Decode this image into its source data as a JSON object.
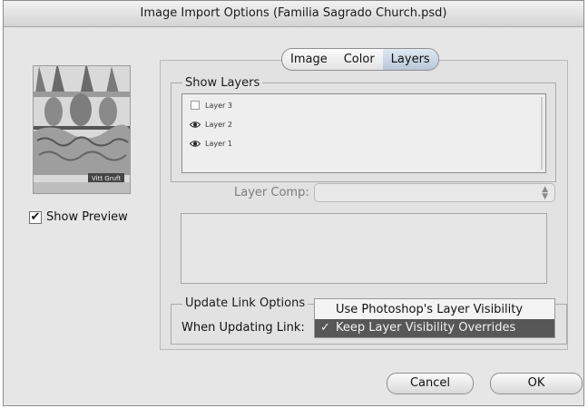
{
  "dialog": {
    "title": "Image Import Options (Familia Sagrado Church.psd)"
  },
  "preview": {
    "show_preview_label": "Show Preview",
    "show_preview_checked": true,
    "thumbnail_caption": "Vitt Gruft"
  },
  "tabs": [
    {
      "label": "Image",
      "active": false
    },
    {
      "label": "Color",
      "active": false
    },
    {
      "label": "Layers",
      "active": true
    }
  ],
  "show_layers": {
    "label": "Show Layers",
    "layers": [
      {
        "name": "Layer 3",
        "visible": false,
        "icon": "empty-checkbox"
      },
      {
        "name": "Layer 2",
        "visible": true,
        "icon": "eye-icon"
      },
      {
        "name": "Layer 1",
        "visible": true,
        "icon": "eye-icon"
      }
    ]
  },
  "layer_comp": {
    "label": "Layer Comp:",
    "value": ""
  },
  "update_link_options": {
    "group_label": "Update Link Options",
    "when_updating_label": "When Updating Link:",
    "options": [
      {
        "label": "Use Photoshop's Layer Visibility",
        "selected": false
      },
      {
        "label": "Keep Layer Visibility Overrides",
        "selected": true
      }
    ],
    "checkmark": "✓"
  },
  "buttons": {
    "cancel": "Cancel",
    "ok": "OK"
  }
}
